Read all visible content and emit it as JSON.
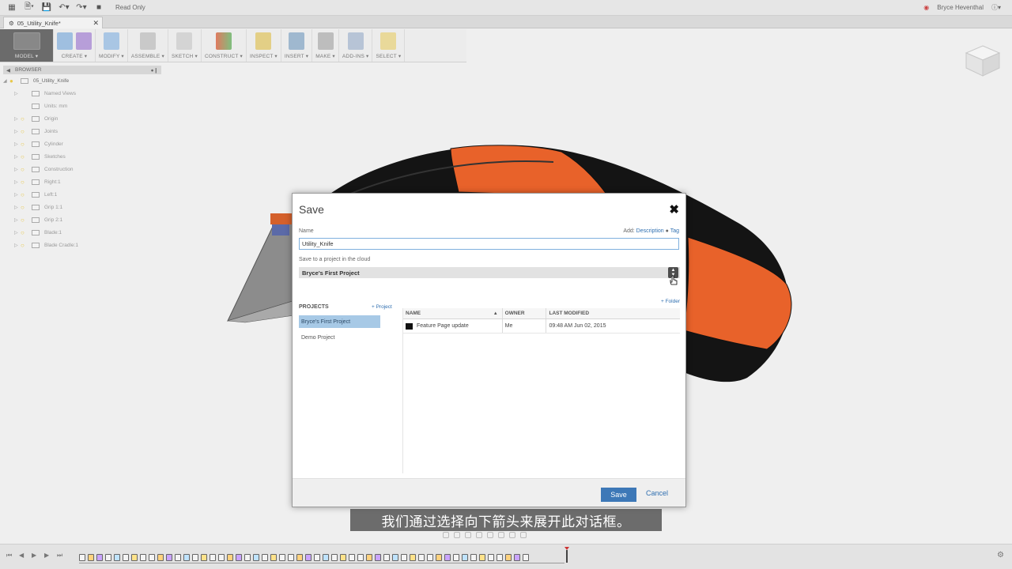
{
  "appbar": {
    "mode_text": "Read Only",
    "user_name": "Bryce Heventhal"
  },
  "tab": {
    "title": "05_Utility_Knife*"
  },
  "toolbar": {
    "groups": [
      {
        "label": "MODEL ▾"
      },
      {
        "label": "CREATE ▾"
      },
      {
        "label": "MODIFY ▾"
      },
      {
        "label": "ASSEMBLE ▾"
      },
      {
        "label": "SKETCH ▾"
      },
      {
        "label": "CONSTRUCT ▾"
      },
      {
        "label": "INSPECT ▾"
      },
      {
        "label": "INSERT ▾"
      },
      {
        "label": "MAKE ▾"
      },
      {
        "label": "ADD-INS ▾"
      },
      {
        "label": "SELECT ▾"
      }
    ]
  },
  "browser": {
    "header": "BROWSER",
    "root": "05_Utility_Knife",
    "items": [
      {
        "label": "Named Views"
      },
      {
        "label": "Units: mm"
      },
      {
        "label": "Origin"
      },
      {
        "label": "Joints"
      },
      {
        "label": "Cylinder"
      },
      {
        "label": "Sketches"
      },
      {
        "label": "Construction"
      },
      {
        "label": "Right:1"
      },
      {
        "label": "Left:1"
      },
      {
        "label": "Grip 1:1"
      },
      {
        "label": "Grip 2:1"
      },
      {
        "label": "Blade:1"
      },
      {
        "label": "Blade Cradle:1"
      }
    ]
  },
  "dialog": {
    "title": "Save",
    "close_glyph": "✖",
    "name_label": "Name",
    "add_label": "Add:",
    "description_link": "Description",
    "tag_link": "Tag",
    "name_value": "Utility_Knife",
    "save_to_label": "Save to a project in the cloud",
    "selected_project": "Bryce's First Project",
    "projects_header": "PROJECTS",
    "add_project": "+ Project",
    "add_folder": "+ Folder",
    "projects": [
      {
        "name": "Bryce's First Project",
        "selected": true
      },
      {
        "name": "Demo Project",
        "selected": false
      }
    ],
    "columns": {
      "name": "NAME",
      "owner": "OWNER",
      "modified": "LAST MODIFIED"
    },
    "files": [
      {
        "name": "Feature Page update",
        "owner": "Me",
        "modified": "09:48 AM Jun 02, 2015"
      }
    ],
    "save_button": "Save",
    "cancel_button": "Cancel"
  },
  "subtitle": "我们通过选择向下箭头来展开此对话框。",
  "colors": {
    "accent": "#3d78b7",
    "selection": "#a7c9e6",
    "model_orange": "#e8622a",
    "model_black": "#141414"
  }
}
